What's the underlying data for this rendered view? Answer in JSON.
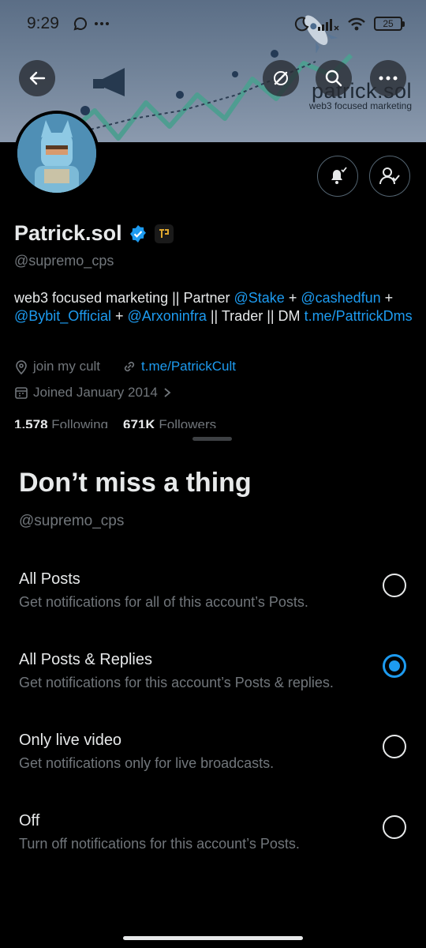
{
  "status_bar": {
    "time": "9:29",
    "battery": "25"
  },
  "banner": {
    "brand_title": "patrick.sol",
    "brand_subtitle": "web3 focused marketing"
  },
  "profile": {
    "display_name": "Patrick.sol",
    "handle": "@supremo_cps",
    "bio": [
      {
        "text": "web3 focused marketing || Partner ",
        "link": false
      },
      {
        "text": "@Stake",
        "link": true
      },
      {
        "text": " + ",
        "link": false
      },
      {
        "text": "@cashedfun",
        "link": true
      },
      {
        "text": " + ",
        "link": false
      },
      {
        "text": "@Bybit_Official",
        "link": true
      },
      {
        "text": " + ",
        "link": false
      },
      {
        "text": "@Arxoninfra",
        "link": true
      },
      {
        "text": " || Trader || DM ",
        "link": false
      },
      {
        "text": "t.me/PattrickDms",
        "link": true
      }
    ],
    "location": "join my cult",
    "website": "t.me/PatrickCult",
    "joined": "Joined January 2014",
    "following_count": "1,578",
    "following_label": "Following",
    "followers_count": "671K",
    "followers_label": "Followers"
  },
  "sheet": {
    "title": "Don’t miss a thing",
    "handle": "@supremo_cps",
    "options": [
      {
        "label": "All Posts",
        "description": "Get notifications for all of this account’s Posts.",
        "selected": false
      },
      {
        "label": "All Posts & Replies",
        "description": "Get notifications for this account’s Posts & replies.",
        "selected": true
      },
      {
        "label": "Only live video",
        "description": "Get notifications only for live broadcasts.",
        "selected": false
      },
      {
        "label": "Off",
        "description": "Turn off notifications for this account’s Posts.",
        "selected": false
      }
    ]
  },
  "colors": {
    "accent": "#1d9bf0",
    "secondary_text": "#71767b",
    "primary_text": "#e7e9ea",
    "background": "#000000"
  }
}
